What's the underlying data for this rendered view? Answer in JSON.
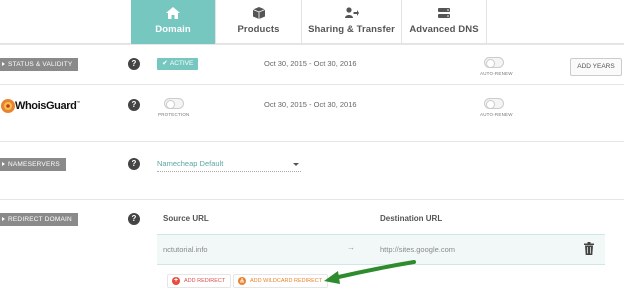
{
  "tabs": [
    {
      "label": "Domain",
      "icon": "home-icon",
      "active": true
    },
    {
      "label": "Products",
      "icon": "package-icon",
      "active": false
    },
    {
      "label": "Sharing & Transfer",
      "icon": "share-user-icon",
      "active": false
    },
    {
      "label": "Advanced DNS",
      "icon": "server-icon",
      "active": false
    }
  ],
  "status_row": {
    "label": "STATUS & VALIDITY",
    "help": "?",
    "badge": "ACTIVE",
    "dates": "Oct 30, 2015 - Oct 30, 2016",
    "toggle_label": "AUTO-RENEW",
    "button": "ADD YEARS"
  },
  "whoisguard_row": {
    "logo_text": "WhoisGuard",
    "trademark": "™",
    "help": "?",
    "toggle_label": "PROTECTION",
    "dates": "Oct 30, 2015 - Oct 30, 2016",
    "autorenew_label": "AUTO-RENEW"
  },
  "nameservers_row": {
    "label": "NAMESERVERS",
    "help": "?",
    "selected": "Namecheap Default"
  },
  "redirect_row": {
    "label": "REDIRECT DOMAIN",
    "help": "?",
    "headers": {
      "source": "Source URL",
      "destination": "Destination URL"
    },
    "entries": [
      {
        "source": "nctutorial.info",
        "arrow": "→",
        "destination": "http://sites.google.com"
      }
    ],
    "add_redirect": "ADD REDIRECT",
    "add_wildcard": "ADD WILDCARD REDIRECT"
  },
  "colors": {
    "accent": "#76c7c0",
    "label_bg": "#8a8a8a",
    "add_red": "#e74c3c",
    "add_orange": "#e8842f",
    "annotation_arrow": "#2e8b2e"
  }
}
